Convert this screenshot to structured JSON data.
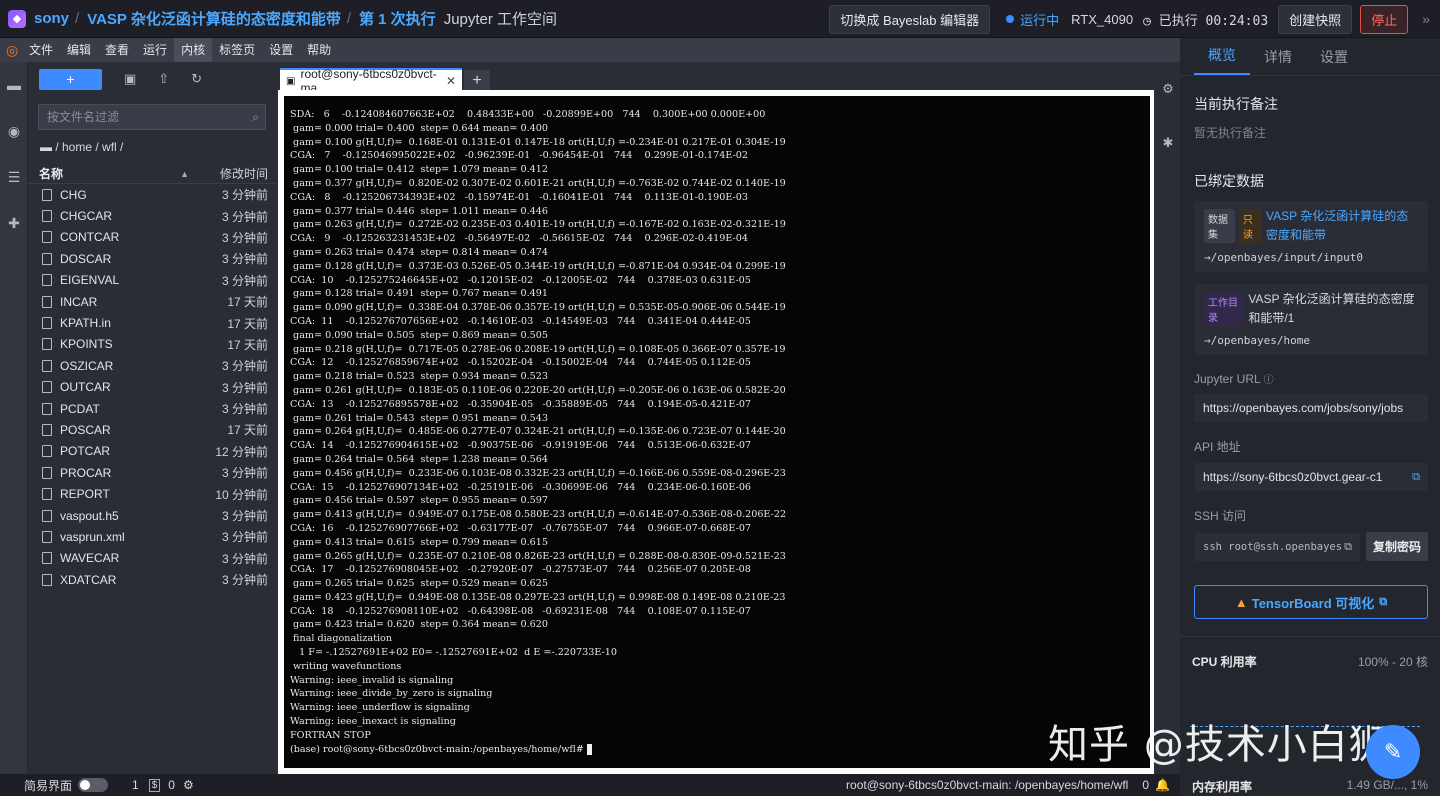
{
  "header": {
    "user": "sony",
    "job_title": "VASP 杂化泛函计算硅的态密度和能带",
    "run_label": "第 1 次执行",
    "workspace": "Jupyter 工作空间",
    "switch_editor": "切换成 Bayeslab 编辑器",
    "status": "运行中",
    "gpu": "RTX_4090",
    "elapsed": "已执行 00:24:03",
    "snapshot": "创建快照",
    "stop": "停止"
  },
  "menu": [
    "文件",
    "编辑",
    "查看",
    "运行",
    "内核",
    "标签页",
    "设置",
    "帮助"
  ],
  "file_panel": {
    "new_label": "+",
    "filter_placeholder": "按文件名过滤",
    "breadcrumb": "/ home / wfl /",
    "col_name": "名称",
    "col_time": "修改时间",
    "files": [
      {
        "name": "CHG",
        "time": "3 分钟前"
      },
      {
        "name": "CHGCAR",
        "time": "3 分钟前"
      },
      {
        "name": "CONTCAR",
        "time": "3 分钟前"
      },
      {
        "name": "DOSCAR",
        "time": "3 分钟前"
      },
      {
        "name": "EIGENVAL",
        "time": "3 分钟前"
      },
      {
        "name": "INCAR",
        "time": "17 天前"
      },
      {
        "name": "KPATH.in",
        "time": "17 天前"
      },
      {
        "name": "KPOINTS",
        "time": "17 天前"
      },
      {
        "name": "OSZICAR",
        "time": "3 分钟前"
      },
      {
        "name": "OUTCAR",
        "time": "3 分钟前"
      },
      {
        "name": "PCDAT",
        "time": "3 分钟前"
      },
      {
        "name": "POSCAR",
        "time": "17 天前"
      },
      {
        "name": "POTCAR",
        "time": "12 分钟前"
      },
      {
        "name": "PROCAR",
        "time": "3 分钟前"
      },
      {
        "name": "REPORT",
        "time": "10 分钟前"
      },
      {
        "name": "vaspout.h5",
        "time": "3 分钟前"
      },
      {
        "name": "vasprun.xml",
        "time": "3 分钟前"
      },
      {
        "name": "WAVECAR",
        "time": "3 分钟前"
      },
      {
        "name": "XDATCAR",
        "time": "3 分钟前"
      }
    ]
  },
  "terminal": {
    "tab_title": "root@sony-6tbcs0z0bvct-ma",
    "lines": [
      "SDA:   6    -0.124084607663E+02    0.48433E+00   -0.20899E+00   744    0.300E+00 0.000E+00",
      " gam= 0.000 trial= 0.400  step= 0.644 mean= 0.400",
      " gam= 0.100 g(H,U,f)=  0.168E-01 0.131E-01 0.147E-18 ort(H,U,f) =-0.234E-01 0.217E-01 0.304E-19",
      "CGA:   7    -0.125046995022E+02   -0.96239E-01   -0.96454E-01   744    0.299E-01-0.174E-02",
      " gam= 0.100 trial= 0.412  step= 1.079 mean= 0.412",
      " gam= 0.377 g(H,U,f)=  0.820E-02 0.307E-02 0.601E-21 ort(H,U,f) =-0.763E-02 0.744E-02 0.140E-19",
      "CGA:   8    -0.125206734393E+02   -0.15974E-01   -0.16041E-01   744    0.113E-01-0.190E-03",
      " gam= 0.377 trial= 0.446  step= 1.011 mean= 0.446",
      " gam= 0.263 g(H,U,f)=  0.272E-02 0.235E-03 0.401E-19 ort(H,U,f) =-0.167E-02 0.163E-02-0.321E-19",
      "CGA:   9    -0.125263231453E+02   -0.56497E-02   -0.56615E-02   744    0.296E-02-0.419E-04",
      " gam= 0.263 trial= 0.474  step= 0.814 mean= 0.474",
      " gam= 0.128 g(H,U,f)=  0.373E-03 0.526E-05 0.344E-19 ort(H,U,f) =-0.871E-04 0.934E-04 0.299E-19",
      "CGA:  10    -0.125275246645E+02   -0.12015E-02   -0.12005E-02   744    0.378E-03 0.631E-05",
      " gam= 0.128 trial= 0.491  step= 0.767 mean= 0.491",
      " gam= 0.090 g(H,U,f)=  0.338E-04 0.378E-06 0.357E-19 ort(H,U,f) = 0.535E-05-0.906E-06 0.544E-19",
      "CGA:  11    -0.125276707656E+02   -0.14610E-03   -0.14549E-03   744    0.341E-04 0.444E-05",
      " gam= 0.090 trial= 0.505  step= 0.869 mean= 0.505",
      " gam= 0.218 g(H,U,f)=  0.717E-05 0.278E-06 0.208E-19 ort(H,U,f) = 0.108E-05 0.366E-07 0.357E-19",
      "CGA:  12    -0.125276859674E+02   -0.15202E-04   -0.15002E-04   744    0.744E-05 0.112E-05",
      " gam= 0.218 trial= 0.523  step= 0.934 mean= 0.523",
      " gam= 0.261 g(H,U,f)=  0.183E-05 0.110E-06 0.220E-20 ort(H,U,f) =-0.205E-06 0.163E-06 0.582E-20",
      "CGA:  13    -0.125276895578E+02   -0.35904E-05   -0.35889E-05   744    0.194E-05-0.421E-07",
      " gam= 0.261 trial= 0.543  step= 0.951 mean= 0.543",
      " gam= 0.264 g(H,U,f)=  0.485E-06 0.277E-07 0.324E-21 ort(H,U,f) =-0.135E-06 0.723E-07 0.144E-20",
      "CGA:  14    -0.125276904615E+02   -0.90375E-06   -0.91919E-06   744    0.513E-06-0.632E-07",
      " gam= 0.264 trial= 0.564  step= 1.238 mean= 0.564",
      " gam= 0.456 g(H,U,f)=  0.233E-06 0.103E-08 0.332E-23 ort(H,U,f) =-0.166E-06 0.559E-08-0.296E-23",
      "CGA:  15    -0.125276907134E+02   -0.25191E-06   -0.30699E-06   744    0.234E-06-0.160E-06",
      " gam= 0.456 trial= 0.597  step= 0.955 mean= 0.597",
      " gam= 0.413 g(H,U,f)=  0.949E-07 0.175E-08 0.580E-23 ort(H,U,f) =-0.614E-07-0.536E-08-0.206E-22",
      "CGA:  16    -0.125276907766E+02   -0.63177E-07   -0.76755E-07   744    0.966E-07-0.668E-07",
      " gam= 0.413 trial= 0.615  step= 0.799 mean= 0.615",
      " gam= 0.265 g(H,U,f)=  0.235E-07 0.210E-08 0.826E-23 ort(H,U,f) = 0.288E-08-0.830E-09-0.521E-23",
      "CGA:  17    -0.125276908045E+02   -0.27920E-07   -0.27573E-07   744    0.256E-07 0.205E-08",
      " gam= 0.265 trial= 0.625  step= 0.529 mean= 0.625",
      " gam= 0.423 g(H,U,f)=  0.949E-08 0.135E-08 0.297E-23 ort(H,U,f) = 0.998E-08 0.149E-08 0.210E-23",
      "CGA:  18    -0.125276908110E+02   -0.64398E-08   -0.69231E-08   744    0.108E-07 0.115E-07",
      " gam= 0.423 trial= 0.620  step= 0.364 mean= 0.620",
      " final diagonalization",
      "   1 F= -.12527691E+02 E0= -.12527691E+02  d E =-.220733E-10",
      " writing wavefunctions",
      "Warning: ieee_invalid is signaling",
      "Warning: ieee_divide_by_zero is signaling",
      "Warning: ieee_underflow is signaling",
      "Warning: ieee_inexact is signaling",
      "FORTRAN STOP"
    ],
    "prompt": "(base) root@sony-6tbcs0z0bvct-main:/openbayes/home/wfl# "
  },
  "right_panel": {
    "tabs": [
      "概览",
      "详情",
      "设置"
    ],
    "note_title": "当前执行备注",
    "note_empty": "暂无执行备注",
    "bound_title": "已绑定数据",
    "dataset": {
      "badge_type": "数据集",
      "badge_mode": "只读",
      "name": "VASP 杂化泛函计算硅的态密度和能带",
      "path": "→/openbayes/input/input0"
    },
    "workdir": {
      "badge": "工作目录",
      "name": "VASP 杂化泛函计算硅的态密度和能带/1",
      "path": "→/openbayes/home"
    },
    "jupyter_label": "Jupyter URL",
    "jupyter_url": "https://openbayes.com/jobs/sony/jobs",
    "api_label": "API 地址",
    "api_url": "https://sony-6tbcs0z0bvct.gear-c1",
    "ssh_label": "SSH 访问",
    "ssh_cmd": "ssh root@ssh.openbayes",
    "copy_password": "复制密码",
    "tensorboard": "TensorBoard 可视化",
    "cpu_label": "CPU 利用率",
    "cpu_value": "100% - 20 核",
    "mem_label": "内存利用率",
    "mem_value": "1.49 GB/..., 1%"
  },
  "statusbar": {
    "simple_mode": "简易界面",
    "terminals": "1",
    "kernels": "0",
    "path": "root@sony-6tbcs0z0bvct-main: /openbayes/home/wfl",
    "notifications": "0"
  },
  "watermark": "知乎 @技术小白狮"
}
